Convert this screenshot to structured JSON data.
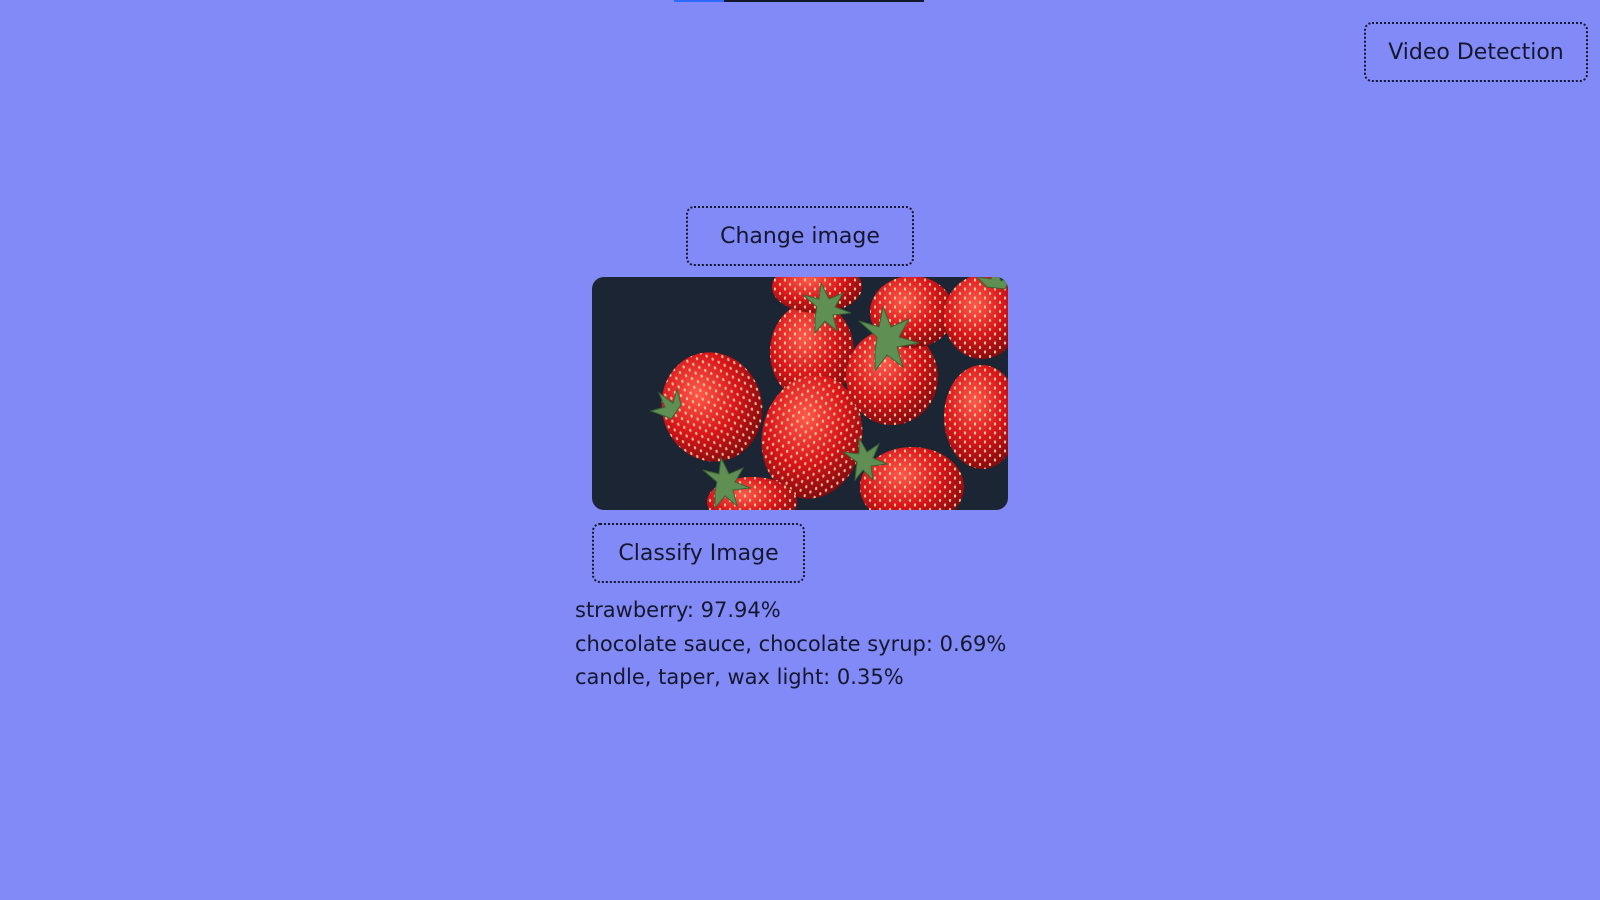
{
  "page": {
    "background_color": "#818af6",
    "top_progress": {
      "value": 0.2,
      "fill_color": "#2b6cff",
      "track_color": "#15172e"
    }
  },
  "toolbar": {
    "video_detection_label": "Video Detection"
  },
  "uploader": {
    "change_image_label": "Change image",
    "preview_image": "strawberries-photo"
  },
  "classifier": {
    "classify_label": "Classify Image",
    "results": [
      {
        "text": "strawberry: 97.94%",
        "label": "strawberry",
        "probability": 97.94
      },
      {
        "text": "chocolate sauce, chocolate syrup: 0.69%",
        "label": "chocolate sauce, chocolate syrup",
        "probability": 0.69
      },
      {
        "text": "candle, taper, wax light: 0.35%",
        "label": "candle, taper, wax light",
        "probability": 0.35
      }
    ]
  }
}
